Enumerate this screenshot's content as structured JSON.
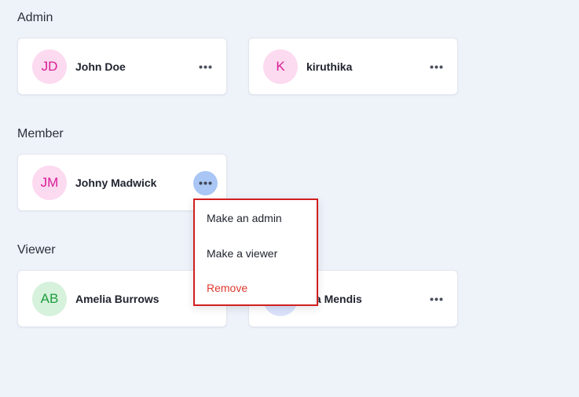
{
  "sections": {
    "admin": {
      "title": "Admin",
      "users": [
        {
          "initials": "JD",
          "name": "John Doe"
        },
        {
          "initials": "K",
          "name": "kiruthika"
        }
      ]
    },
    "member": {
      "title": "Member",
      "users": [
        {
          "initials": "JM",
          "name": "Johny Madwick"
        }
      ]
    },
    "viewer": {
      "title": "Viewer",
      "users": [
        {
          "initials": "AB",
          "name": "Amelia Burrows"
        },
        {
          "initials": "",
          "name": "iza Mendis"
        }
      ]
    }
  },
  "context_menu": {
    "items": [
      {
        "label": "Make an admin"
      },
      {
        "label": "Make a viewer"
      },
      {
        "label": "Remove"
      }
    ]
  },
  "icons": {
    "more": "more-horizontal-icon"
  },
  "colors": {
    "page_background": "#eef2f9",
    "card_background": "#ffffff",
    "avatar_pink_bg": "#fcdaf0",
    "avatar_pink_text": "#d81c95",
    "avatar_green_bg": "#d6f1dc",
    "avatar_green_text": "#1e9d3e",
    "avatar_blue_bg": "#dbe3fb",
    "active_more_button": "#a9c6f4",
    "menu_highlight_border": "#d21f1f",
    "danger_text": "#e03a2e"
  }
}
